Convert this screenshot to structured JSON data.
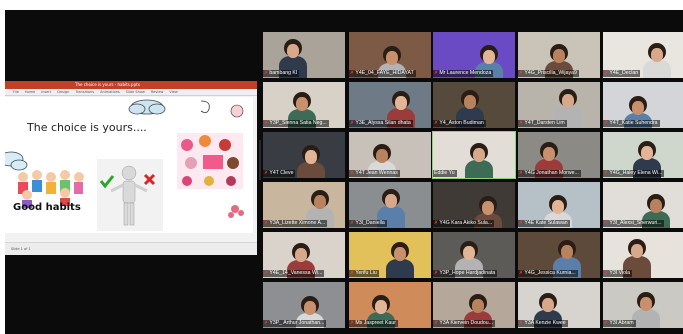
{
  "presentation": {
    "window_title": "The choice is yours - habits.pptx",
    "ribbon_tabs": [
      "File",
      "Home",
      "Insert",
      "Design",
      "Transitions",
      "Animations",
      "Slide Show",
      "Review",
      "View"
    ],
    "slide_title": "The choice is yours....",
    "good_habits_label": "Good habits",
    "status_text": "Slide 1 of 1"
  },
  "participants": [
    {
      "name": "bambang KI",
      "muted": true
    },
    {
      "name": "Y4E_04_FAYE_HIDAYAT",
      "muted": true
    },
    {
      "name": "Mr Laurence Mendoza",
      "muted": true
    },
    {
      "name": "Y4G_Priscilla_Wijaya9",
      "muted": true
    },
    {
      "name": "Y4E_Declan",
      "muted": true
    },
    {
      "name": "Y3P_Sienna Satia Neg...",
      "muted": true
    },
    {
      "name": "Y3E_Alyssa Silan dhata",
      "muted": true
    },
    {
      "name": "Y4_Aston Budiman",
      "muted": true
    },
    {
      "name": "Y4T_Darsten Lim",
      "muted": true
    },
    {
      "name": "Y4T_Katie Suhendra",
      "muted": true
    },
    {
      "name": "Y4T Cleve",
      "muted": true
    },
    {
      "name": "Y4T Jean Wennas",
      "muted": true
    },
    {
      "name": "Eddie Yu",
      "muted": false
    },
    {
      "name": "Y4G Jonathan Morwe...",
      "muted": true
    },
    {
      "name": "Y4G_Haley Elena Wi...",
      "muted": true
    },
    {
      "name": "Y3A_Lizette Ximone A...",
      "muted": true
    },
    {
      "name": "Y3I_Daniella",
      "muted": true
    },
    {
      "name": "Y4G Kara Akiko Sula...",
      "muted": true
    },
    {
      "name": "Y4E Kate Sulawan",
      "muted": true
    },
    {
      "name": "Y3I_Alexsi_Sherwuri...",
      "muted": true
    },
    {
      "name": "Y4E_14_Vanessa Wi...",
      "muted": true
    },
    {
      "name": "Yerifu Liu",
      "muted": true
    },
    {
      "name": "Y3P_Hope Hardjadinata",
      "muted": true
    },
    {
      "name": "Y4G_Jessica Kurnia...",
      "muted": true
    },
    {
      "name": "Y3I Viola",
      "muted": true
    },
    {
      "name": "Y3P_ Arthur Jonathan...",
      "muted": true
    },
    {
      "name": "Ms Jaspreet Kaur",
      "muted": true
    },
    {
      "name": "Y3A Kiervein Doudou...",
      "muted": true
    },
    {
      "name": "Y3A Kenzie Kwee",
      "muted": true
    },
    {
      "name": "Y3I Abram",
      "muted": true
    }
  ],
  "tile_backgrounds": [
    "#a9a39a",
    "#7c5a45",
    "#6a4bc4",
    "#c9c3b8",
    "#e9e6e0",
    "#d7d1c7",
    "#6e7a86",
    "#564a3c",
    "#b9b4ab",
    "#d3d5d8",
    "#3a3c44",
    "#c8c1b9",
    "#e2ddd6",
    "#8c8a85",
    "#cfd7cc",
    "#c8b79e",
    "#8a8e91",
    "#3f3a36",
    "#b6c0c7",
    "#e1ddd9",
    "#d9d3cc",
    "#e3c15a",
    "#5d5b58",
    "#5e4a3a",
    "#e7e3dc",
    "#8e8f92",
    "#d08b5a",
    "#b5a79a",
    "#d7d4cf",
    "#cbc9c4"
  ],
  "accent_colors": {
    "muted_icon": "#ff3b3b",
    "active_speaker": "#8fd16b",
    "ppt_bar": "#c2402a"
  }
}
